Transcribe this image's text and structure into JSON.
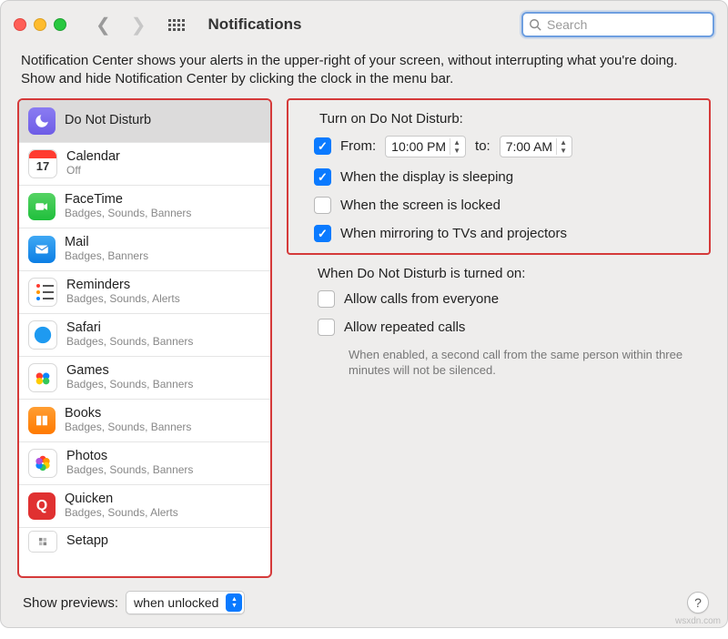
{
  "toolbar": {
    "title": "Notifications",
    "search_placeholder": "Search"
  },
  "intro": "Notification Center shows your alerts in the upper-right of your screen, without interrupting what you're doing. Show and hide Notification Center by clicking the clock in the menu bar.",
  "sidebar": {
    "items": [
      {
        "name": "Do Not Disturb",
        "sub": "",
        "selected": true,
        "icon": "dnd"
      },
      {
        "name": "Calendar",
        "sub": "Off",
        "icon": "cal",
        "badge": "17"
      },
      {
        "name": "FaceTime",
        "sub": "Badges, Sounds, Banners",
        "icon": "ft"
      },
      {
        "name": "Mail",
        "sub": "Badges, Banners",
        "icon": "mail"
      },
      {
        "name": "Reminders",
        "sub": "Badges, Sounds, Alerts",
        "icon": "rem"
      },
      {
        "name": "Safari",
        "sub": "Badges, Sounds, Banners",
        "icon": "saf"
      },
      {
        "name": "Games",
        "sub": "Badges, Sounds, Banners",
        "icon": "games"
      },
      {
        "name": "Books",
        "sub": "Badges, Sounds, Banners",
        "icon": "books"
      },
      {
        "name": "Photos",
        "sub": "Badges, Sounds, Banners",
        "icon": "photos"
      },
      {
        "name": "Quicken",
        "sub": "Badges, Sounds, Alerts",
        "icon": "quicken"
      },
      {
        "name": "Setapp",
        "sub": "",
        "icon": "setapp"
      }
    ]
  },
  "dnd": {
    "heading": "Turn on Do Not Disturb:",
    "from_label": "From:",
    "from_time": "10:00 PM",
    "to_label": "to:",
    "to_time": "7:00 AM",
    "opts": [
      {
        "label": "When the display is sleeping",
        "checked": true
      },
      {
        "label": "When the screen is locked",
        "checked": false
      },
      {
        "label": "When mirroring to TVs and projectors",
        "checked": true
      }
    ]
  },
  "when_on": {
    "heading": "When Do Not Disturb is turned on:",
    "opts": [
      {
        "label": "Allow calls from everyone",
        "checked": false
      },
      {
        "label": "Allow repeated calls",
        "checked": false
      }
    ],
    "hint": "When enabled, a second call from the same person within three minutes will not be silenced."
  },
  "footer": {
    "label": "Show previews:",
    "value": "when unlocked"
  },
  "watermark": "wsxdn.com"
}
